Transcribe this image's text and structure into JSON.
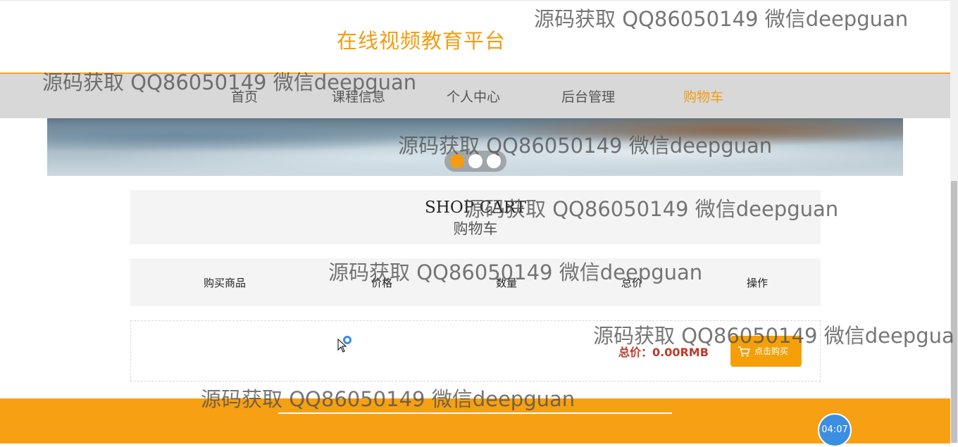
{
  "site": {
    "title": "在线视频教育平台"
  },
  "nav": {
    "items": [
      {
        "label": "首页"
      },
      {
        "label": "课程信息"
      },
      {
        "label": "个人中心"
      },
      {
        "label": "后台管理"
      },
      {
        "label": "购物车"
      }
    ],
    "active": "购物车",
    "accent_color": "#f39c12"
  },
  "carousel": {
    "slide_count": 3,
    "active_index": 0
  },
  "cart": {
    "title_en": "SHOP CART",
    "title_cn": "购物车",
    "columns": [
      "购买商品",
      "价格",
      "数量",
      "总价",
      "操作"
    ],
    "rows": [],
    "total_label": "总价：0.00RMB",
    "buy_button": "点击购买",
    "buy_icon": "cart-icon"
  },
  "timer": {
    "value": "04:07"
  },
  "watermark": "源码获取 QQ86050149 微信deepguan",
  "watermark_clipped": "源码获取 QQ86050149 微信deepgua"
}
